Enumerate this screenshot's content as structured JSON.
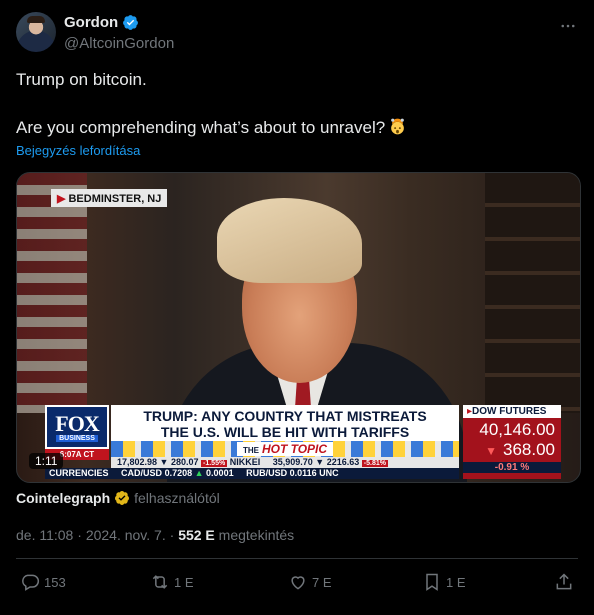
{
  "author": {
    "name": "Gordon",
    "handle": "@AltcoinGordon"
  },
  "tweet": {
    "line1": "Trump on bitcoin.",
    "line2": "Are you comprehending what’s about to unravel?",
    "emoji": "exploding-head",
    "translate_label": "Bejegyzés lefordítása"
  },
  "media": {
    "location": "BEDMINSTER, NJ",
    "network": "FOX",
    "network_sub": "BUSINESS",
    "network_time": "6:07A CT",
    "headline_1": "TRUMP: ANY COUNTRY THAT MISTREATS",
    "headline_2": "THE U.S. WILL BE HIT WITH TARIFFS",
    "hot_the": "THE",
    "hot_topic": "HOT TOPIC",
    "ticker_row1_a": "17,802.98",
    "ticker_row1_b": "280.07",
    "ticker_row1_c": "-1.55%",
    "ticker_row1_d": "NIKKEI",
    "ticker_row1_e": "35,909.70",
    "ticker_row1_f": "2216.63",
    "ticker_row1_g": "-5.81%",
    "ticker_row2_a": "CURRENCIES",
    "ticker_row2_b": "CAD/USD",
    "ticker_row2_c": "0.7208",
    "ticker_row2_d": "0.0001",
    "ticker_row2_e": "RUB/USD",
    "ticker_row2_f": "0.0116",
    "ticker_row2_g": "UNC",
    "dow_label": "DOW FUTURES",
    "dow_value": "40,146.00",
    "dow_change": "368.00",
    "dow_pct": "-0.91 %",
    "duration": "1:11"
  },
  "attribution": {
    "source": "Cointelegraph",
    "suffix": "felhasználótól"
  },
  "meta": {
    "time": "de. 11:08",
    "date": "2024. nov. 7.",
    "views": "552 E",
    "views_label": "megtekintés"
  },
  "stats": {
    "replies": "153",
    "reposts": "1 E",
    "likes": "7 E",
    "bookmarks": "1 E"
  },
  "colors": {
    "background": "#000000",
    "accent": "#1d9bf0",
    "muted": "#71767b",
    "text": "#e7e9ea"
  }
}
